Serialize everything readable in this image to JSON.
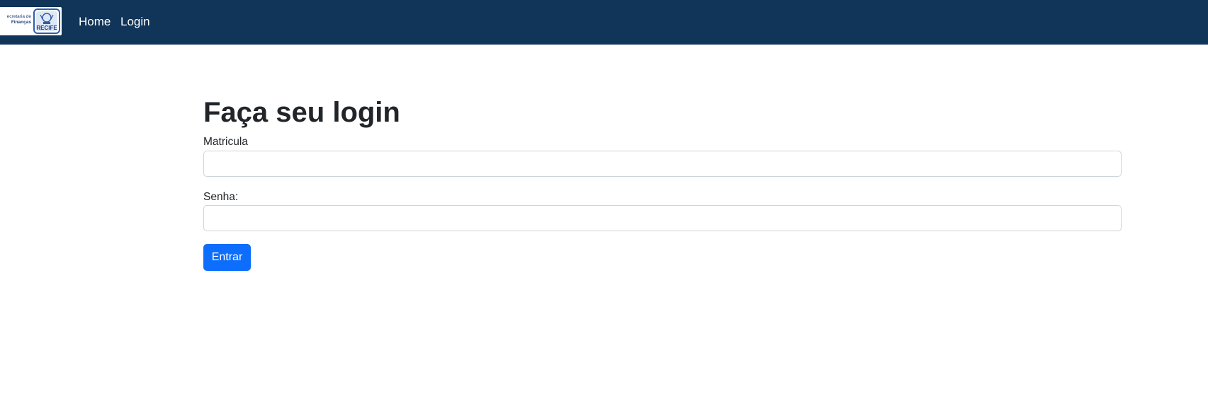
{
  "navbar": {
    "logo": {
      "line1": "ecretaria de",
      "line2": "Finanças",
      "badge_text": "RECIFE",
      "icon": "recife-crest-icon"
    },
    "links": [
      {
        "label": "Home"
      },
      {
        "label": "Login"
      }
    ]
  },
  "form": {
    "title": "Faça seu login",
    "matricula_label": "Matricula",
    "matricula_value": "",
    "senha_label": "Senha:",
    "senha_value": "",
    "submit_label": "Entrar"
  },
  "colors": {
    "navbar_bg": "#113459",
    "primary": "#0d6efd",
    "text": "#212529",
    "input_border": "#ced4da"
  }
}
